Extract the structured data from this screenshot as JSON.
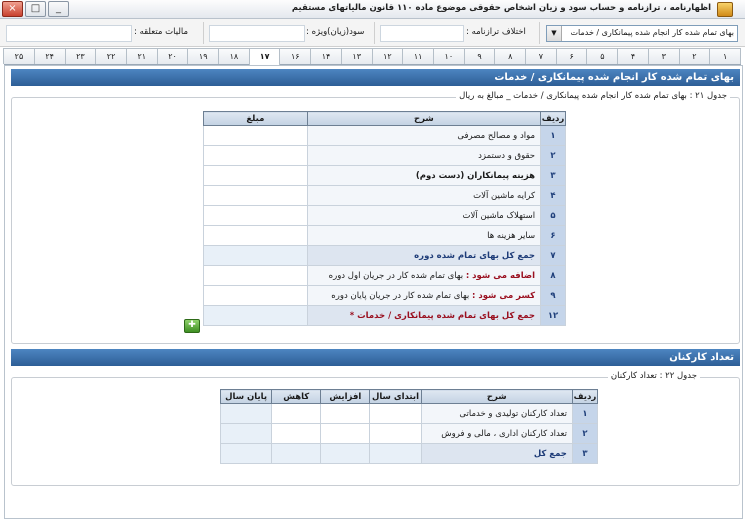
{
  "window": {
    "title": "اظهارنامه ، ترازنامه و حساب سود و زیان اشخاص حقوقی موضوع ماده ۱۱۰ قانون مالیاتهای مستقیم",
    "controls": [
      "_",
      "□",
      "×"
    ]
  },
  "toolbar": {
    "form_select": "بهای تمام شده کار انجام شده پیمانکاری / خدمات",
    "balance_diff_label": "اختلاف ترازنامه :",
    "profit_label": "سود(زیان)ویژه :",
    "tax_label": "مالیات متعلقه :"
  },
  "tabs": [
    "۱",
    "۲",
    "۳",
    "۴",
    "۵",
    "۶",
    "۷",
    "۸",
    "۹",
    "۱۰",
    "۱۱",
    "۱۲",
    "۱۳",
    "۱۴",
    "۱۶",
    "۱۷",
    "۱۸",
    "۱۹",
    "۲۰",
    "۲۱",
    "۲۲",
    "۲۳",
    "۲۴",
    "۲۵"
  ],
  "active_tab_index": 15,
  "section1": {
    "header": "بهای تمام شده کار انجام شده پیمانکاری / خدمات",
    "caption": "جدول ۲۱ : بهای تمام شده کار انجام شده پیمانکاری / خدمات _ مبالغ به ریال",
    "columns": {
      "row": "ردیف",
      "description": "شرح",
      "amount": "مبلغ"
    },
    "rows": [
      {
        "num": "۱",
        "label": "مواد و مصالح مصرفی"
      },
      {
        "num": "۲",
        "label": "حقوق و دستمزد"
      },
      {
        "num": "۳",
        "label": "هزینه پیمانکاران (دست دوم)"
      },
      {
        "num": "۴",
        "label": "کرایه ماشین آلات"
      },
      {
        "num": "۵",
        "label": "استهلاک ماشین آلات"
      },
      {
        "num": "۶",
        "label": "سایر هزینه ها"
      },
      {
        "num": "۷",
        "label": "جمع کل بهای تمام شده دوره"
      },
      {
        "num": "۸",
        "prefix": "اضافه می شود :",
        "label": "بهای تمام شده کار در جریان اول دوره"
      },
      {
        "num": "۹",
        "prefix": "کسر می شود :",
        "label": "بهای تمام شده کار در جریان پایان دوره"
      },
      {
        "num": "۱۲",
        "label": "جمع کل بهای تمام شده پیمانکاری / خدمات *"
      }
    ]
  },
  "section2": {
    "header": "تعداد کارکنان",
    "caption": "جدول ۲۲ : تعداد کارکنان",
    "columns": {
      "row": "ردیف",
      "description": "شرح",
      "start": "ابتدای سال",
      "increase": "افزایش",
      "decrease": "کاهش",
      "end": "پایان سال"
    },
    "rows": [
      {
        "num": "۱",
        "label": "تعداد کارکنان تولیدی و خدماتی"
      },
      {
        "num": "۲",
        "label": "تعداد کارکنان اداری ، مالی و فروش"
      },
      {
        "num": "۳",
        "label": "جمع کل"
      }
    ]
  },
  "icons": {
    "add": "add-row-icon"
  }
}
